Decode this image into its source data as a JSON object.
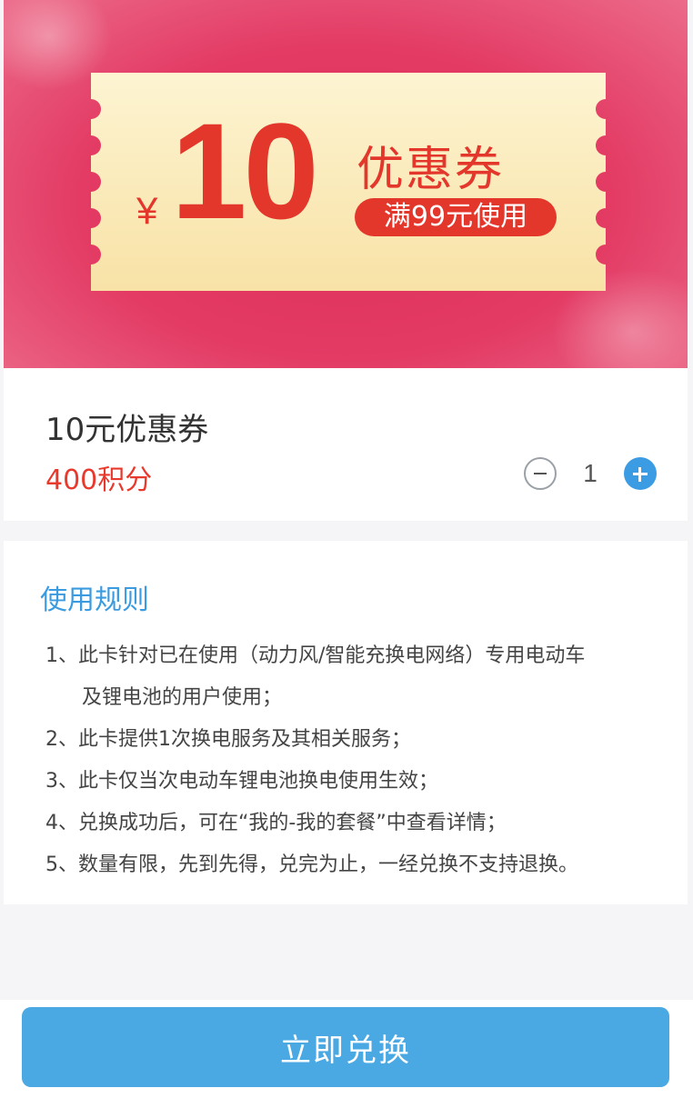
{
  "banner": {
    "currency_symbol": "¥",
    "amount": "10",
    "coupon_title": "优惠券",
    "condition": "满99元使用",
    "colors": {
      "banner_bg": "#e33b64",
      "ticket_bg": "#fdf1c4",
      "accent_red": "#e4372c"
    }
  },
  "product": {
    "name": "10元优惠券",
    "price": "400积分",
    "quantity": "1",
    "minus_icon": "minus-circle-icon",
    "plus_icon": "plus-circle-icon"
  },
  "rules": {
    "title": "使用规则",
    "items": [
      {
        "line1": "1、此卡针对已在使用（动力风/智能充换电网络）专用电动车",
        "line2": "及锂电池的用户使用；"
      },
      {
        "line1": "2、此卡提供1次换电服务及其相关服务；"
      },
      {
        "line1": "3、此卡仅当次电动车锂电池换电使用生效；"
      },
      {
        "line1": "4、兑换成功后，可在“我的-我的套餐”中查看详情；"
      },
      {
        "line1": "5、数量有限，先到先得，兑完为止，一经兑换不支持退换。"
      }
    ]
  },
  "footer": {
    "redeem_label": "立即兑换",
    "button_color": "#4aa8e3"
  }
}
